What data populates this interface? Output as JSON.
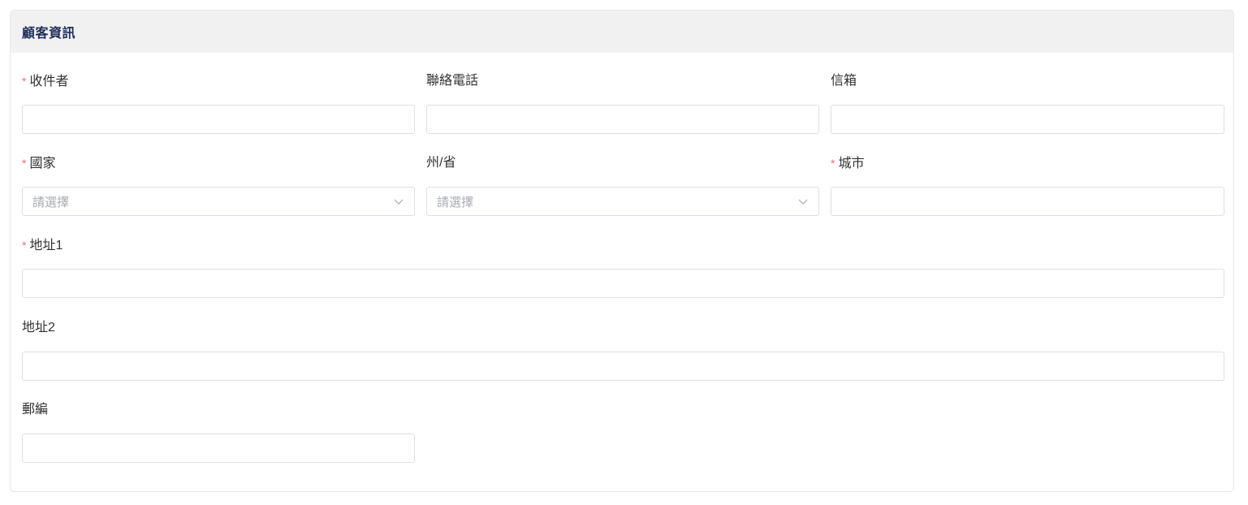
{
  "card": {
    "title": "顧客資訊"
  },
  "fields": {
    "recipient": {
      "label": "收件者",
      "required": true,
      "value": ""
    },
    "phone": {
      "label": "聯絡電話",
      "required": false,
      "value": ""
    },
    "email": {
      "label": "信箱",
      "required": false,
      "value": ""
    },
    "country": {
      "label": "國家",
      "required": true,
      "placeholder": "請選擇"
    },
    "state": {
      "label": "州/省",
      "required": false,
      "placeholder": "請選擇"
    },
    "city": {
      "label": "城市",
      "required": true,
      "value": ""
    },
    "address1": {
      "label": "地址1",
      "required": true,
      "value": ""
    },
    "address2": {
      "label": "地址2",
      "required": false,
      "value": ""
    },
    "zip": {
      "label": "郵編",
      "required": false,
      "value": ""
    }
  },
  "required_marker": "*",
  "colors": {
    "required": "#f56c6c",
    "title": "#1f2d5a",
    "header_bg": "#f1f1f1",
    "border": "#dcdfe6",
    "placeholder": "#a8abb2"
  },
  "icons": {
    "select_arrow": "chevron-down-icon"
  }
}
